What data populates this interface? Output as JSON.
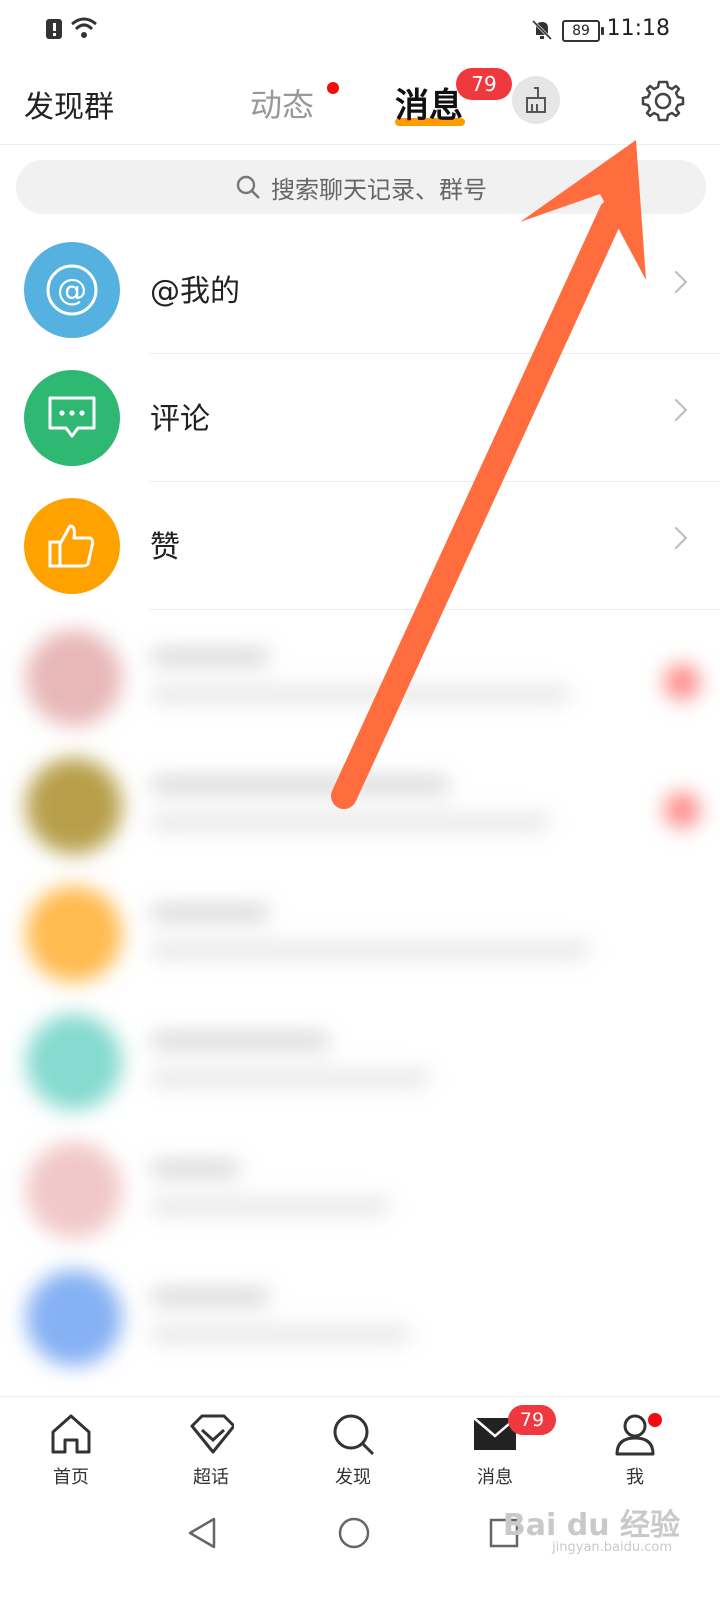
{
  "status_bar": {
    "time": "11:18",
    "battery": "89"
  },
  "header": {
    "discover_groups": "发现群",
    "tabs": [
      {
        "label": "动态",
        "dot": true
      },
      {
        "label": "消息",
        "active": true,
        "badge": "79"
      }
    ]
  },
  "search": {
    "placeholder": "搜索聊天记录、群号"
  },
  "list": {
    "items": [
      {
        "label": "@我的",
        "icon": "at-icon",
        "color": "#55b1df"
      },
      {
        "label": "评论",
        "icon": "comment-icon",
        "color": "#2fb872"
      },
      {
        "label": "赞",
        "icon": "thumbs-up-icon",
        "color": "#ffa200"
      }
    ]
  },
  "tabbar": {
    "items": [
      {
        "label": "首页",
        "icon": "home-icon"
      },
      {
        "label": "超话",
        "icon": "diamond-icon"
      },
      {
        "label": "发现",
        "icon": "search-icon"
      },
      {
        "label": "消息",
        "icon": "mail-icon",
        "badge": "79"
      },
      {
        "label": "我",
        "icon": "person-icon",
        "dot": true
      }
    ]
  },
  "watermark": {
    "text": "Bai du 经验",
    "sub": "jingyan.baidu.com"
  },
  "colors": {
    "accent": "#ff9b00",
    "badge": "#f0393f",
    "arrow": "#ff6d3f"
  }
}
